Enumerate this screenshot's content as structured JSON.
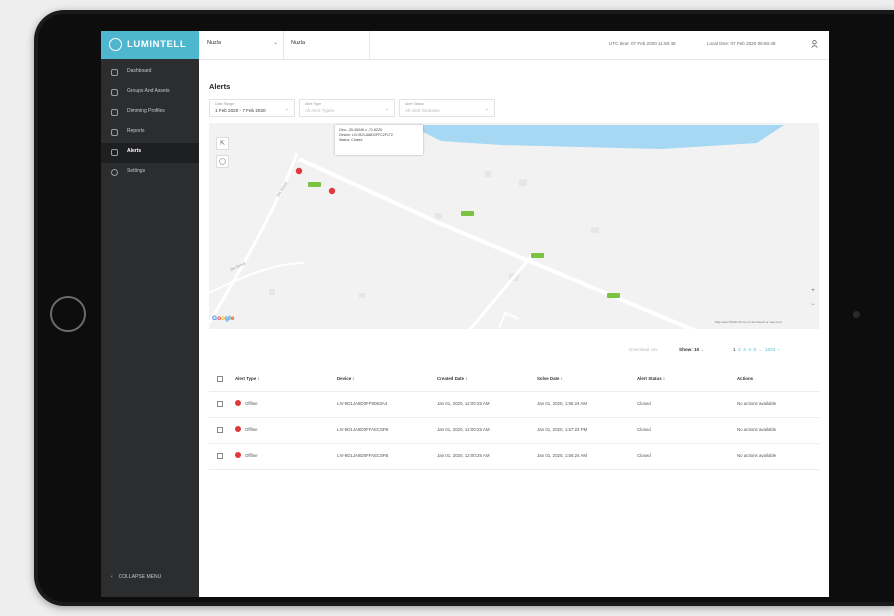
{
  "brand": {
    "name": "LUMINTELL"
  },
  "sidebar": {
    "items": [
      {
        "label": "Dashboard",
        "icon": "home-icon"
      },
      {
        "label": "Groups And Assets",
        "icon": "location-pin-icon"
      },
      {
        "label": "Dimming Profiles",
        "icon": "bulb-icon"
      },
      {
        "label": "Reports",
        "icon": "chart-icon"
      },
      {
        "label": "Alerts",
        "icon": "bell-icon",
        "active": true
      },
      {
        "label": "Settings",
        "icon": "gear-icon"
      }
    ],
    "collapse_label": "COLLAPSE MENU"
  },
  "topbar": {
    "select1": "Nuzla",
    "select2": "Nuzla",
    "utc_time": "UTC time: 07 Feb 2020 11:50:49",
    "local_time": "Local time: 07 Feb 2020 08:50:49"
  },
  "page": {
    "title": "Alerts"
  },
  "filters": [
    {
      "label": "Date Range",
      "value": "1 Feb 2020 - 7 Feb 2020",
      "placeholder": false
    },
    {
      "label": "Alert Type",
      "value": "All Alert Types",
      "placeholder": true
    },
    {
      "label": "Alert Status",
      "value": "All Alert Statuses",
      "placeholder": true
    }
  ],
  "map": {
    "popup": {
      "line1": "Geo: -35.40046 x -71.6225",
      "line2": "Device: LIV-9D1JA8D0FFC2F172",
      "line3": "Status: Closed"
    },
    "road_labels": [
      "De Groot",
      "De Groot"
    ],
    "logo": {
      "g1": "G",
      "o1": "o",
      "o2": "o",
      "g2": "g",
      "l": "l",
      "e": "e"
    },
    "attribution": "Map data ©2020   Terms of Use   Report a map error",
    "zoom_in": "+",
    "zoom_out": "−"
  },
  "pagination": {
    "prev": "Download csv",
    "show_label": "Show:",
    "show_value": "10",
    "pages": [
      "1",
      "2",
      "3",
      "4",
      "5"
    ],
    "ellipsis": "...",
    "last_page": "1024",
    "next": "›"
  },
  "table": {
    "headers": [
      "Alert Type ↕",
      "Device ↕",
      "Created Date ↕",
      "Solve Date ↕",
      "Alert Status ↕",
      "Actions"
    ],
    "rows": [
      [
        "Offline",
        "LIV-9D1JA8D0FF9D83A4",
        "Jan 01, 2020, 12:00:25 AM",
        "Jan 01, 2020, 1:56:24 AM",
        "Closed",
        "No actions available"
      ],
      [
        "Offline",
        "LIV-9D1JA8D0FFAEC5FB",
        "Jan 01, 2020, 12:00:25 AM",
        "Jan 01, 2020, 1:57:23 PM",
        "Closed",
        "No actions available"
      ],
      [
        "Offline",
        "LIV-9D1JA8D0FFAEC5FB",
        "Jan 01, 2020, 12:00:25 AM",
        "Jan 01, 2020, 1:56:24 AM",
        "Closed",
        "No actions available"
      ]
    ]
  },
  "colors": {
    "accent": "#4fb6cf",
    "sidebar": "#2b2d2f",
    "alert": "#e0393b",
    "lake": "#a6d8f4"
  }
}
